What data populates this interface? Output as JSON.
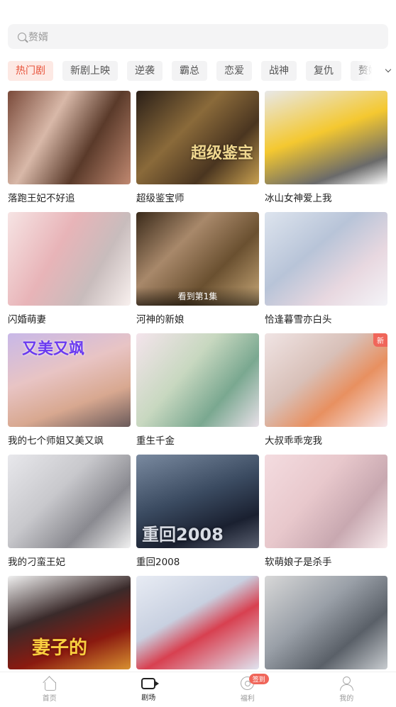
{
  "search": {
    "placeholder": "赘婿"
  },
  "tags": [
    "热门剧",
    "新剧上映",
    "逆袭",
    "霸总",
    "恋爱",
    "战神",
    "复仇",
    "赘婿"
  ],
  "dramas": [
    {
      "title": "落跑王妃不好追"
    },
    {
      "title": "超级鉴宝师"
    },
    {
      "title": "冰山女神爱上我"
    },
    {
      "title": "闪婚萌妻"
    },
    {
      "title": "河神的新娘",
      "progress": "看到第1集"
    },
    {
      "title": "恰逢暮雪亦白头"
    },
    {
      "title": "我的七个师姐又美又飒"
    },
    {
      "title": "重生千金"
    },
    {
      "title": "大叔乖乖宠我",
      "badge": "新"
    },
    {
      "title": "我的刁蛮王妃"
    },
    {
      "title": "重回2008"
    },
    {
      "title": "软萌娘子是杀手"
    },
    {
      "title": ""
    },
    {
      "title": ""
    },
    {
      "title": ""
    }
  ],
  "poster_texts": {
    "p1": "超级鉴宝",
    "p6": "又美又飒",
    "p10": "重回2008",
    "p12": "妻子的"
  },
  "nav": {
    "home": "首页",
    "theater": "剧场",
    "welfare": "福利",
    "welfare_badge": "签到",
    "mine": "我的"
  },
  "colors": {
    "accent": "#e8533a",
    "badge": "#f0665a"
  }
}
